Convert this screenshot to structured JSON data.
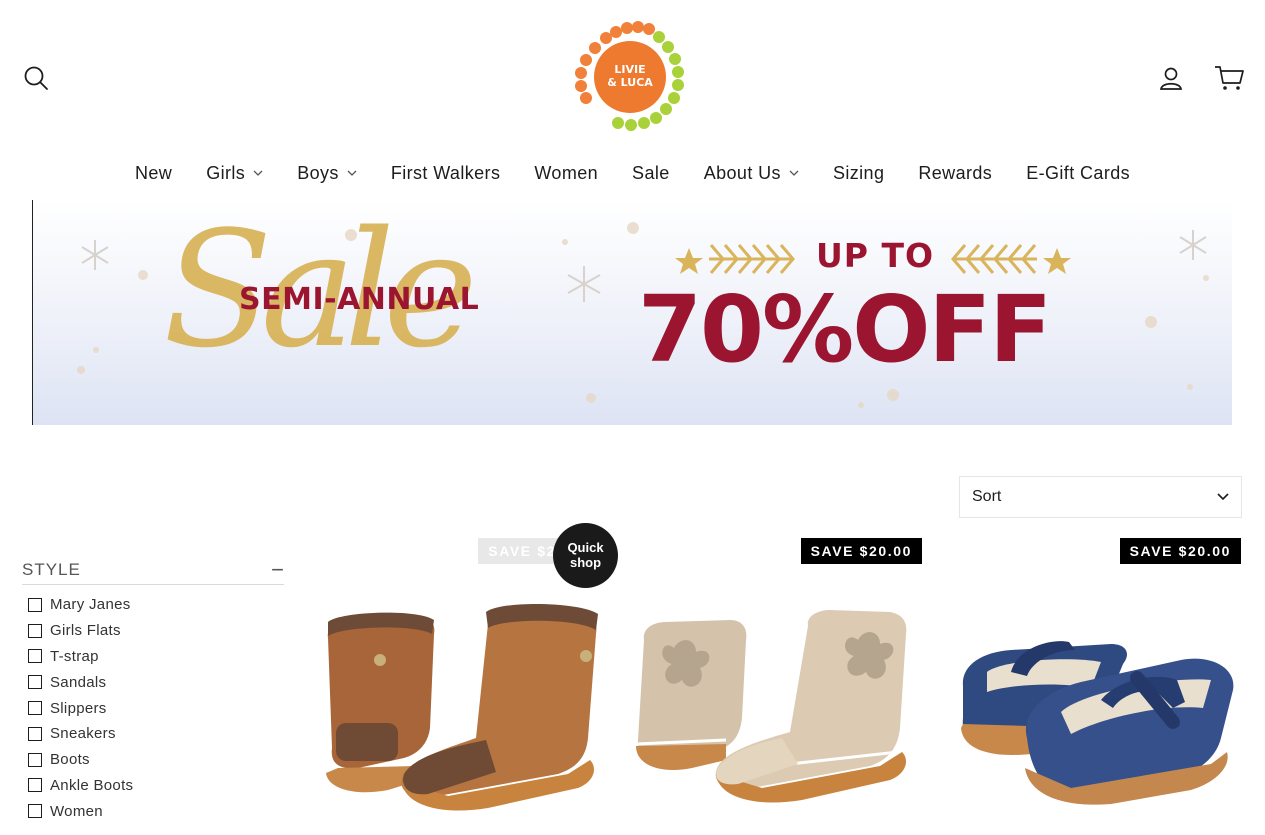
{
  "header": {
    "logo_text_line1": "LIVIE",
    "logo_text_line2": "& LUCA",
    "icons": {
      "search": "search-icon",
      "account": "user-icon",
      "cart": "cart-icon"
    }
  },
  "nav": {
    "items": [
      {
        "label": "New",
        "has_dropdown": false
      },
      {
        "label": "Girls",
        "has_dropdown": true
      },
      {
        "label": "Boys",
        "has_dropdown": true
      },
      {
        "label": "First Walkers",
        "has_dropdown": false
      },
      {
        "label": "Women",
        "has_dropdown": false
      },
      {
        "label": "Sale",
        "has_dropdown": false
      },
      {
        "label": "About Us",
        "has_dropdown": true
      },
      {
        "label": "Sizing",
        "has_dropdown": false
      },
      {
        "label": "Rewards",
        "has_dropdown": false
      },
      {
        "label": "E-Gift Cards",
        "has_dropdown": false
      }
    ]
  },
  "banner": {
    "semi_annual": "SEMI-ANNUAL",
    "sale_script": "Sale",
    "up_to": "UP TO",
    "discount": "70%OFF",
    "colors": {
      "red": "#9c1530",
      "gold": "#d9b45b"
    }
  },
  "sort": {
    "label": "Sort"
  },
  "filter": {
    "title": "STYLE",
    "toggle": "−",
    "options": [
      "Mary Janes",
      "Girls Flats",
      "T-strap",
      "Sandals",
      "Slippers",
      "Sneakers",
      "Boots",
      "Ankle Boots",
      "Women"
    ]
  },
  "products": [
    {
      "badge": "SAVE $20.00",
      "badge_visible_text": "SAVE $2",
      "image": "brown-suede-boots",
      "quick_shop": "Quick shop"
    },
    {
      "badge": "SAVE $20.00",
      "image": "beige-butterfly-boots"
    },
    {
      "badge": "SAVE $20.00",
      "image": "navy-mary-janes"
    }
  ]
}
